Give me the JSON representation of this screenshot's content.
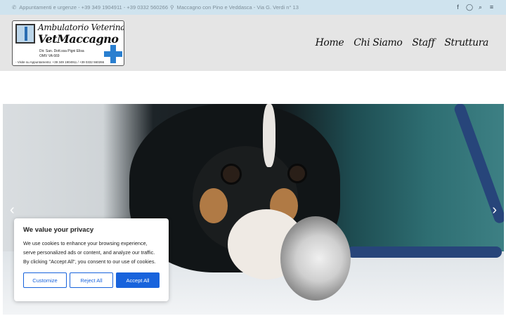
{
  "topbar": {
    "phone_text": "Appuntamenti e urgenze - +39 349 1904911 - +39 0332 560266",
    "address_text": "Maccagno con Pino e Veddasca - Via G. Verdi n° 13",
    "icons": [
      "facebook-icon",
      "whatsapp-icon",
      "search-icon",
      "menu-icon"
    ]
  },
  "logo": {
    "line1": "Ambulatorio Veterinario",
    "line2": "VetMaccagno",
    "line3": "Dir. San. Dott.ssa Pigni Elisa",
    "line4": "OMV VA 669",
    "line5": "- Visite su Appuntamento: +39 349 1904911 / +39 0332 560266"
  },
  "nav": {
    "items": [
      {
        "label": "Home"
      },
      {
        "label": "Chi Siamo"
      },
      {
        "label": "Staff"
      },
      {
        "label": "Struttura"
      }
    ]
  },
  "slider": {
    "prev_glyph": "‹",
    "next_glyph": "›"
  },
  "cookie_banner": {
    "title": "We value your privacy",
    "text": "We use cookies to enhance your browsing experience, serve personalized ads or content, and analyze our traffic. By clicking \"Accept All\", you consent to our use of cookies.",
    "customize_label": "Customize",
    "reject_label": "Reject All",
    "accept_label": "Accept All",
    "accent_color": "#1863dc"
  }
}
